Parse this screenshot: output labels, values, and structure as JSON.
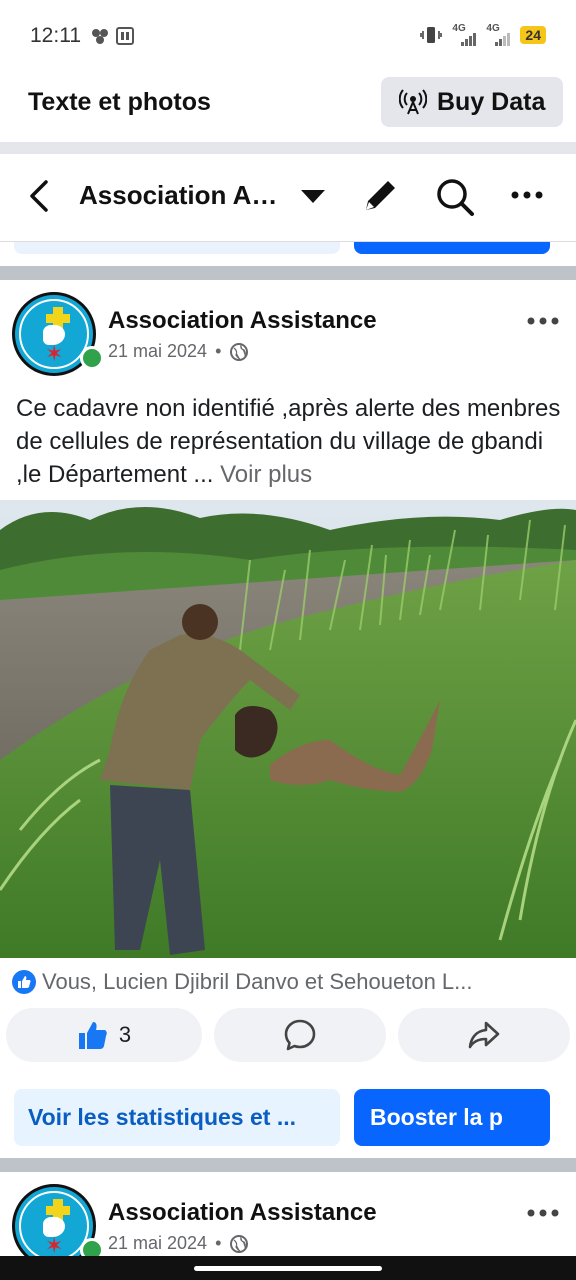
{
  "status_bar": {
    "time": "12:11",
    "network_1": "4G",
    "network_2": "4G",
    "battery": "24"
  },
  "topbar": {
    "title": "Texte et photos",
    "buy_data_label": "Buy Data"
  },
  "page_header": {
    "page_name": "Association Assistance",
    "icons": [
      "back-arrow-icon",
      "dropdown-caret-icon",
      "pencil-icon",
      "search-icon",
      "more-icon"
    ]
  },
  "posts": [
    {
      "author": "Association Assistance",
      "date": "21 mai 2024",
      "separator": "•",
      "text": "Ce cadavre non identifié ,après alerte des menbres de cellules de représentation du village de gbandi ,le Département ... ",
      "voir_plus": "Voir plus",
      "reactions_text": "Vous, Lucien Djibril Danvo et Sehoueton L...",
      "like_count": "3",
      "stats_button": "Voir les statistiques et ...",
      "boost_button": "Booster la p"
    },
    {
      "author": "Association Assistance",
      "date": "21 mai 2024",
      "separator": "•"
    }
  ],
  "colors": {
    "primary": "#0866ff",
    "online": "#31a24c",
    "secondary_text": "#65676b"
  }
}
